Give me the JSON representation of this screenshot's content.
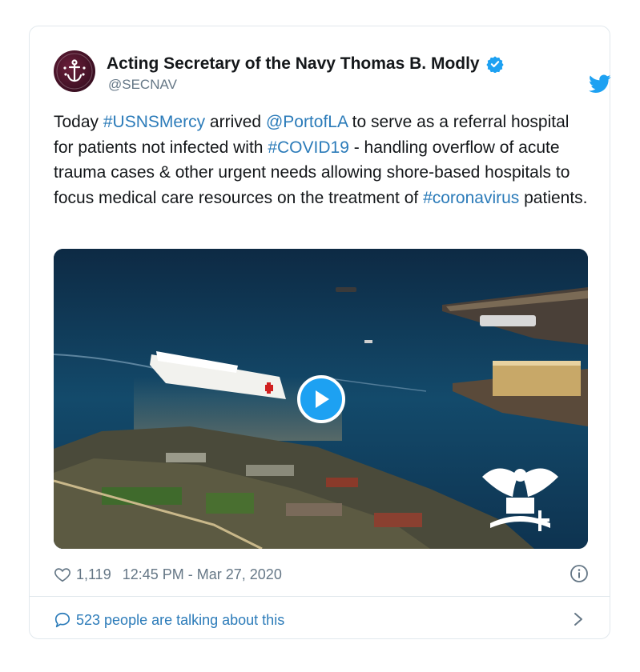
{
  "tweet": {
    "author_name": "Acting Secretary of the Navy Thomas B. Modly",
    "handle": "@SECNAV",
    "text": [
      {
        "t": "Today ",
        "link": false
      },
      {
        "t": "#USNSMercy",
        "link": true
      },
      {
        "t": " arrived ",
        "link": false
      },
      {
        "t": "@PortofLA",
        "link": true
      },
      {
        "t": " to serve as a referral hospital for patients not infected with ",
        "link": false
      },
      {
        "t": "#COVID19",
        "link": true
      },
      {
        "t": " - handling overflow of acute trauma cases & other urgent needs allowing shore-based hospitals to focus medical care resources on the treatment of ",
        "link": false
      },
      {
        "t": "#coronavirus",
        "link": true
      },
      {
        "t": " patients.",
        "link": false
      }
    ],
    "likes": "1,119",
    "timestamp": "12:45 PM - Mar 27, 2020",
    "conversation": "523 people are talking about this"
  },
  "icons": {
    "avatar": "navy-anchor-avatar-icon",
    "verified": "verified-badge-icon",
    "brand": "twitter-bird-icon",
    "play": "play-icon",
    "like": "heart-icon",
    "info": "info-icon",
    "reply": "speech-bubble-icon",
    "chevron": "chevron-right-icon"
  },
  "colors": {
    "link": "#2b7bb9",
    "brand_blue": "#1da1f2",
    "muted": "#657786",
    "text": "#14171a",
    "border": "#e1e8ed"
  }
}
